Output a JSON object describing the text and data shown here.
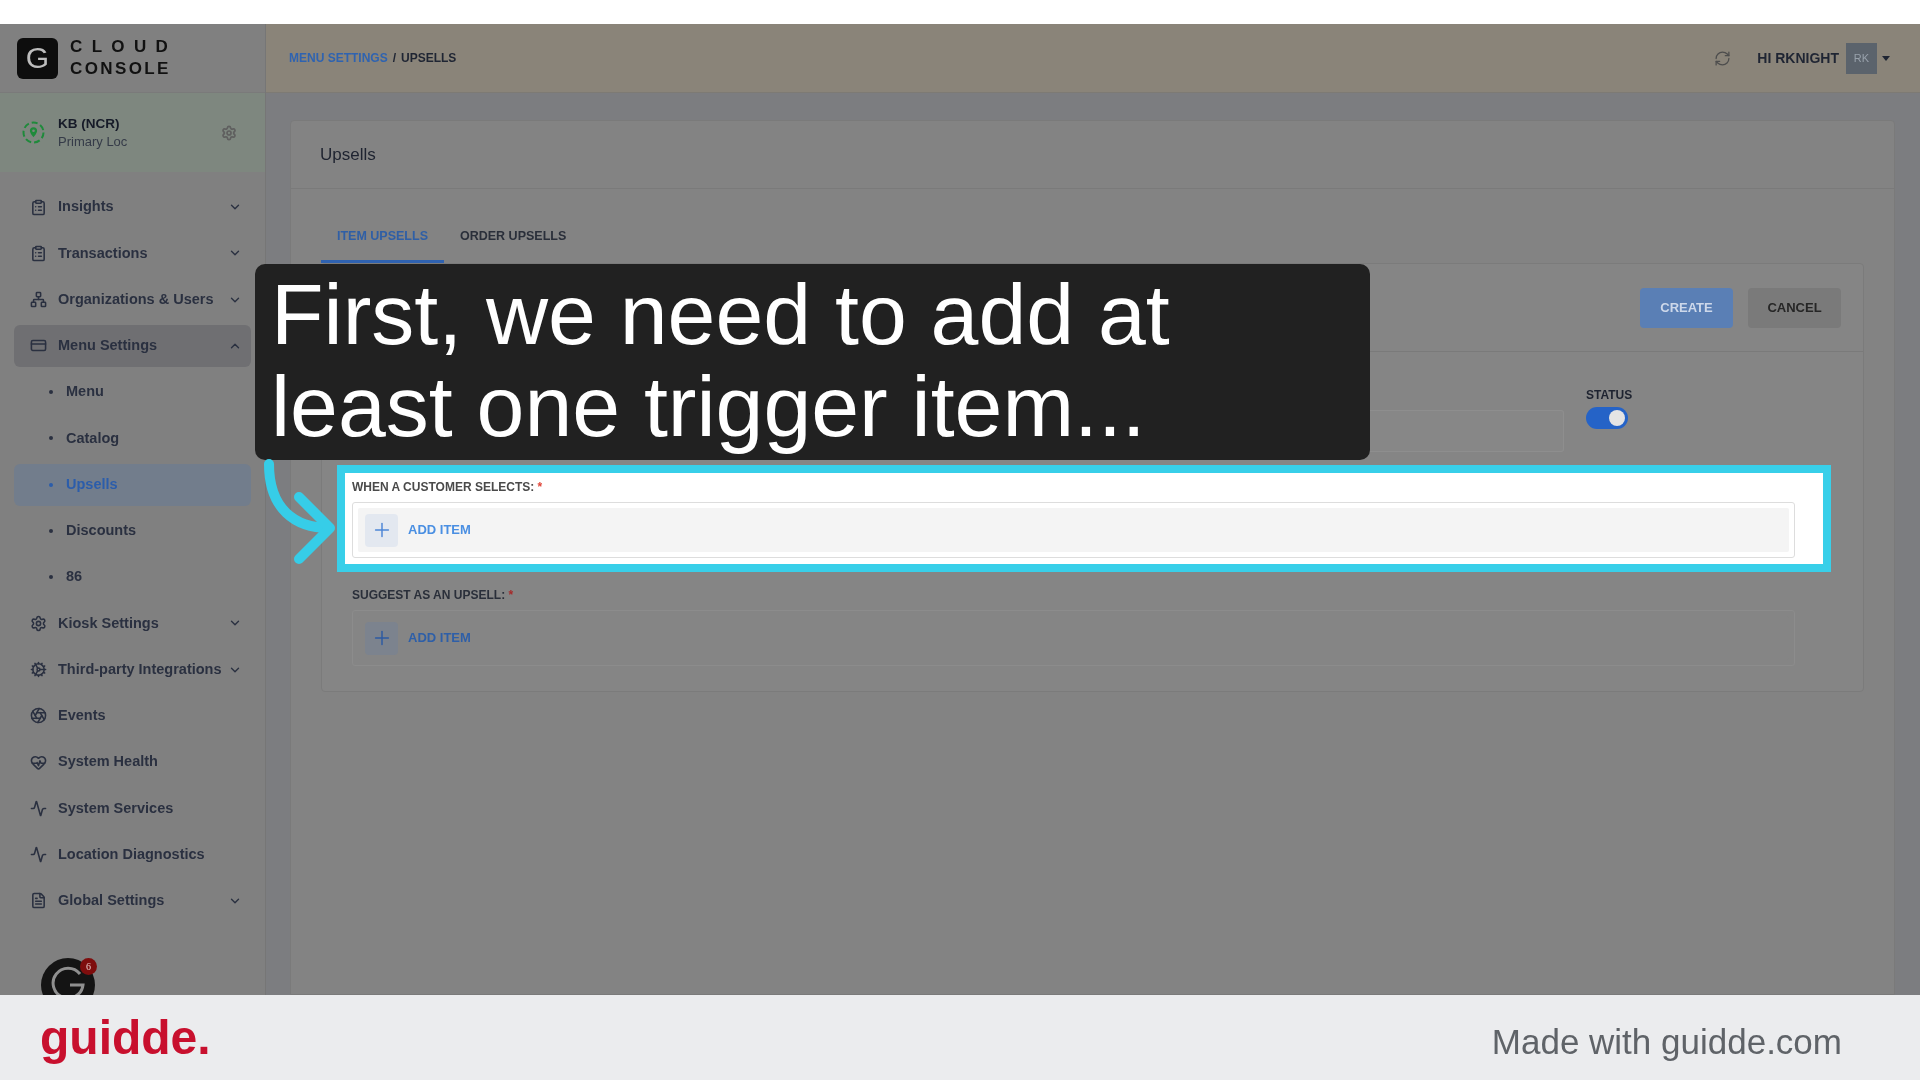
{
  "logo": {
    "mark": "G",
    "line1": "CLOUD",
    "line2": "CONSOLE"
  },
  "location": {
    "name": "KB (NCR)",
    "subtitle": "Primary Loc"
  },
  "sidebar": {
    "items": [
      {
        "label": "Insights",
        "selected": false,
        "expanded": false
      },
      {
        "label": "Transactions",
        "selected": false,
        "expanded": false
      },
      {
        "label": "Organizations & Users",
        "selected": false,
        "expanded": false
      },
      {
        "label": "Menu Settings",
        "selected": true,
        "expanded": true,
        "children": [
          {
            "label": "Menu",
            "selected": false
          },
          {
            "label": "Catalog",
            "selected": false
          },
          {
            "label": "Upsells",
            "selected": true
          },
          {
            "label": "Discounts",
            "selected": false
          },
          {
            "label": "86",
            "selected": false
          }
        ]
      },
      {
        "label": "Kiosk Settings",
        "selected": false,
        "expanded": false
      },
      {
        "label": "Third-party Integrations",
        "selected": false,
        "expanded": false
      },
      {
        "label": "Events",
        "selected": false
      },
      {
        "label": "System Health",
        "selected": false
      },
      {
        "label": "System Services",
        "selected": false
      },
      {
        "label": "Location Diagnostics",
        "selected": false
      },
      {
        "label": "Global Settings",
        "selected": false,
        "expanded": false
      }
    ]
  },
  "launcher": {
    "badge": "6"
  },
  "breadcrumb": [
    {
      "label": "MENU SETTINGS",
      "kind": "link"
    },
    {
      "label": "/",
      "kind": "separator"
    },
    {
      "label": "UPSELLS",
      "kind": "current"
    }
  ],
  "user": {
    "greeting": "HI RKNIGHT",
    "initials": "RK"
  },
  "page": {
    "title": "Upsells",
    "tabs": [
      {
        "label": "ITEM UPSELLS",
        "selected": true
      },
      {
        "label": "ORDER UPSELLS",
        "selected": false
      }
    ],
    "actions": [
      {
        "label": "CREATE",
        "kind": "primary"
      },
      {
        "label": "CANCEL",
        "kind": "secondary"
      }
    ],
    "status": {
      "label": "STATUS",
      "on": true
    },
    "sections": [
      {
        "label": "WHEN A CUSTOMER SELECTS:",
        "required": "*",
        "highlighted": true,
        "add_label": "ADD ITEM"
      },
      {
        "label": "SUGGEST AS AN UPSELL:",
        "required": "*",
        "highlighted": false,
        "add_label": "ADD ITEM"
      }
    ]
  },
  "caption": {
    "lines": [
      "First, we need to add at",
      "least one trigger item..."
    ]
  },
  "footer": {
    "brand": "guidde.",
    "credit": "Made with guidde.com"
  }
}
